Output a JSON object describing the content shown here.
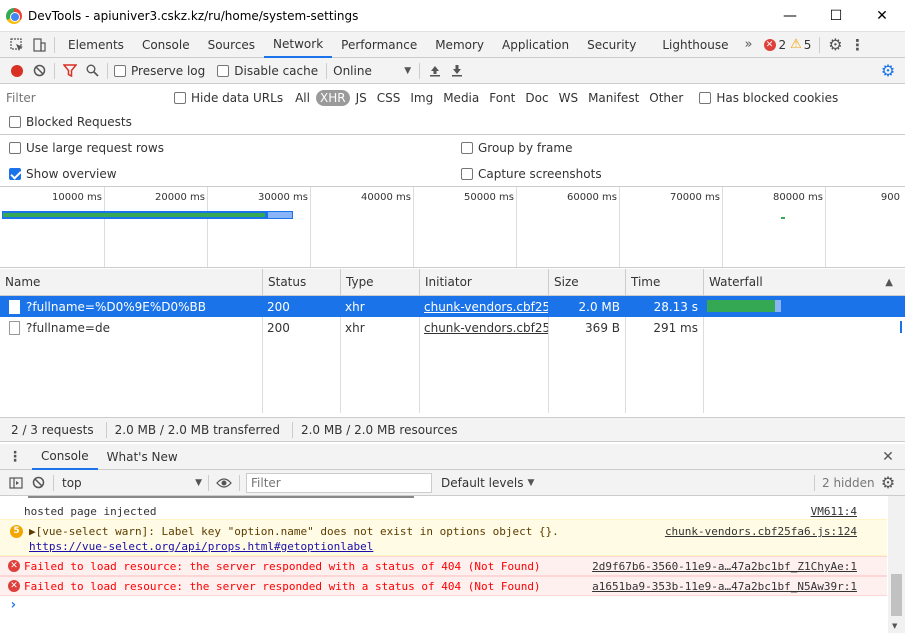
{
  "window": {
    "title": "DevTools - apiuniver3.cskz.kz/ru/home/system-settings"
  },
  "tabs": [
    "Elements",
    "Console",
    "Sources",
    "Network",
    "Performance",
    "Memory",
    "Application",
    "Security",
    "Lighthouse"
  ],
  "issues": {
    "errors": "2",
    "warnings": "5"
  },
  "toolbar": {
    "preserve_log": "Preserve log",
    "disable_cache": "Disable cache",
    "throttle": "Online"
  },
  "filter": {
    "placeholder": "Filter",
    "hide_data_urls": "Hide data URLs",
    "types": [
      "All",
      "XHR",
      "JS",
      "CSS",
      "Img",
      "Media",
      "Font",
      "Doc",
      "WS",
      "Manifest",
      "Other"
    ],
    "active_type": "XHR",
    "has_blocked_cookies": "Has blocked cookies",
    "blocked_requests": "Blocked Requests"
  },
  "options": {
    "large_rows": "Use large request rows",
    "group_by_frame": "Group by frame",
    "show_overview": "Show overview",
    "capture_screenshots": "Capture screenshots"
  },
  "overview": {
    "ticks": [
      "10000 ms",
      "20000 ms",
      "30000 ms",
      "40000 ms",
      "50000 ms",
      "60000 ms",
      "70000 ms",
      "80000 ms",
      "900"
    ]
  },
  "grid": {
    "headers": {
      "name": "Name",
      "status": "Status",
      "type": "Type",
      "initiator": "Initiator",
      "size": "Size",
      "time": "Time",
      "waterfall": "Waterfall"
    },
    "rows": [
      {
        "name": "?fullname=%D0%9E%D0%BB",
        "status": "200",
        "type": "xhr",
        "initiator": "chunk-vendors.cbf25...",
        "size": "2.0 MB",
        "time": "28.13 s"
      },
      {
        "name": "?fullname=de",
        "status": "200",
        "type": "xhr",
        "initiator": "chunk-vendors.cbf25...",
        "size": "369 B",
        "time": "291 ms"
      }
    ]
  },
  "status": {
    "requests": "2 / 3 requests",
    "transferred": "2.0 MB / 2.0 MB transferred",
    "resources": "2.0 MB / 2.0 MB resources"
  },
  "drawer": {
    "tabs": [
      "Console",
      "What's New"
    ]
  },
  "console_toolbar": {
    "context": "top",
    "filter_placeholder": "Filter",
    "levels": "Default levels",
    "hidden": "2 hidden"
  },
  "console": {
    "messages": [
      {
        "level": "info",
        "text": "hosted page injected",
        "source": "VM611:4"
      },
      {
        "level": "warning",
        "count": "5",
        "text": "▶[vue-select warn]: Label key \"option.name\" does not exist in options object {}.",
        "link": "https://vue-select.org/api/props.html#getoptionlabel",
        "source": "chunk-vendors.cbf25fa6.js:124"
      },
      {
        "level": "error",
        "text": "Failed to load resource: the server responded with a status of 404 (Not Found)",
        "source": "2d9f67b6-3560-11e9-a…47a2bc1bf_Z1ChyAe:1"
      },
      {
        "level": "error",
        "text": "Failed to load resource: the server responded with a status of 404 (Not Found)",
        "source": "a1651ba9-353b-11e9-a…47a2bc1bf_N5Aw39r:1"
      }
    ],
    "prompt": "›"
  },
  "colors": {
    "accent": "#1a73e8",
    "record": "#d93025",
    "error": "#e0403b",
    "warning": "#f2a600"
  }
}
